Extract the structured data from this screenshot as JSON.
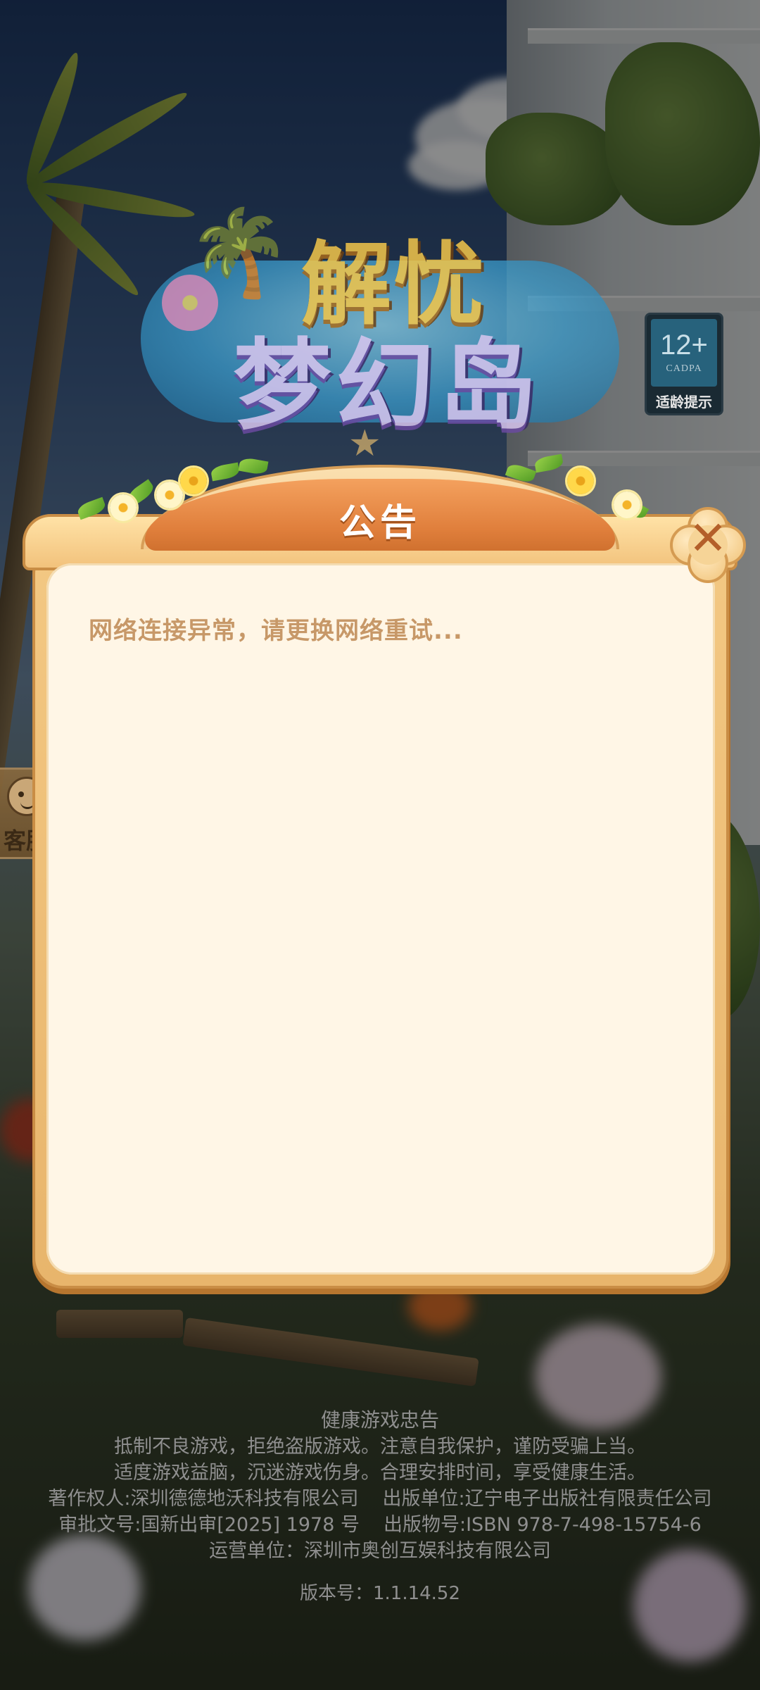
{
  "logo": {
    "line1": "解忧",
    "line2": "梦幻岛"
  },
  "age_badge": {
    "rating": "12+",
    "org": "CADPA",
    "tip": "适龄提示"
  },
  "customer_service": {
    "label": "客服"
  },
  "dialog": {
    "title": "公告",
    "message": "网络连接异常，请更换网络重试...",
    "close_icon": "close-icon"
  },
  "footer": {
    "heading": "健康游戏忠告",
    "advice_line1": "抵制不良游戏，拒绝盗版游戏。注意自我保护，谨防受骗上当。",
    "advice_line2": "适度游戏益脑，沉迷游戏伤身。合理安排时间，享受健康生活。",
    "copyright": "著作权人:深圳德德地沃科技有限公司",
    "publisher": "出版单位:辽宁电子出版社有限责任公司",
    "approval": "审批文号:国新出审[2025] 1978 号",
    "isbn": "出版物号:ISBN 978-7-498-15754-6",
    "operator": "运营单位：深圳市奥创互娱科技有限公司",
    "version": "版本号：1.1.14.52"
  },
  "colors": {
    "dialog_panel": "#fff6e6",
    "title_plate": "#e07f3c",
    "message_text": "#c79868",
    "footer_text": "#8f8f8f"
  }
}
